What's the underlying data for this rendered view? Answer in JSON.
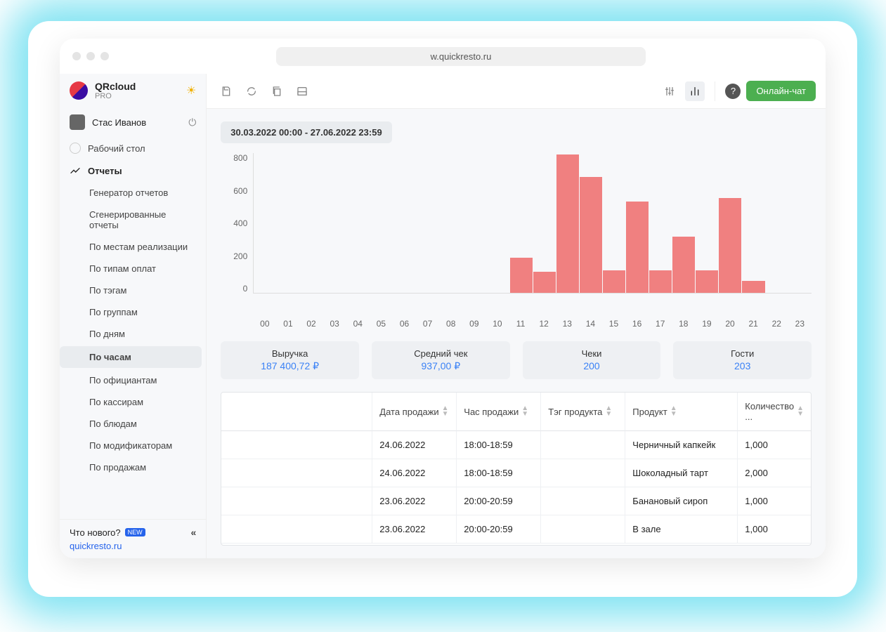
{
  "browser": {
    "url": "w.quickresto.ru"
  },
  "brand": {
    "name": "QRcloud",
    "plan": "PRO"
  },
  "user": {
    "name": "Стас Иванов"
  },
  "nav": {
    "dashboard": "Рабочий стол",
    "reports": "Отчеты",
    "items": [
      "Генератор отчетов",
      "Сгенерированные отчеты",
      "По местам реализации",
      "По типам оплат",
      "По тэгам",
      "По группам",
      "По дням",
      "По часам",
      "По официантам",
      "По кассирам",
      "По блюдам",
      "По модификаторам",
      "По продажам"
    ]
  },
  "footer": {
    "whatsnew": "Что нового?",
    "new_badge": "NEW",
    "link": "quickresto.ru"
  },
  "toolbar": {
    "online_chat": "Онлайн-чат"
  },
  "date_range": "30.03.2022 00:00 - 27.06.2022 23:59",
  "metrics": [
    {
      "label": "Выручка",
      "value": "187 400,72 ₽"
    },
    {
      "label": "Средний чек",
      "value": "937,00 ₽"
    },
    {
      "label": "Чеки",
      "value": "200"
    },
    {
      "label": "Гости",
      "value": "203"
    }
  ],
  "table": {
    "headers": [
      "",
      "Дата продажи",
      "Час продажи",
      "Тэг продукта",
      "Продукт",
      "Количество ..."
    ],
    "rows": [
      [
        "",
        "24.06.2022",
        "18:00-18:59",
        "",
        "Черничный капкейк",
        "1,000"
      ],
      [
        "",
        "24.06.2022",
        "18:00-18:59",
        "",
        "Шоколадный тарт",
        "2,000"
      ],
      [
        "",
        "23.06.2022",
        "20:00-20:59",
        "",
        "Банановый сироп",
        "1,000"
      ],
      [
        "",
        "23.06.2022",
        "20:00-20:59",
        "",
        "В зале",
        "1,000"
      ]
    ]
  },
  "chart_data": {
    "type": "bar",
    "categories": [
      "00",
      "01",
      "02",
      "03",
      "04",
      "05",
      "06",
      "07",
      "08",
      "09",
      "10",
      "11",
      "12",
      "13",
      "14",
      "15",
      "16",
      "17",
      "18",
      "19",
      "20",
      "21",
      "22",
      "23"
    ],
    "values": [
      0,
      0,
      0,
      0,
      0,
      0,
      0,
      0,
      0,
      0,
      0,
      200,
      120,
      790,
      660,
      130,
      520,
      130,
      320,
      130,
      540,
      70,
      0,
      0
    ],
    "xlabel": "",
    "ylabel": "",
    "ylim": [
      0,
      800
    ],
    "yticks": [
      0,
      200,
      400,
      600,
      800
    ]
  }
}
